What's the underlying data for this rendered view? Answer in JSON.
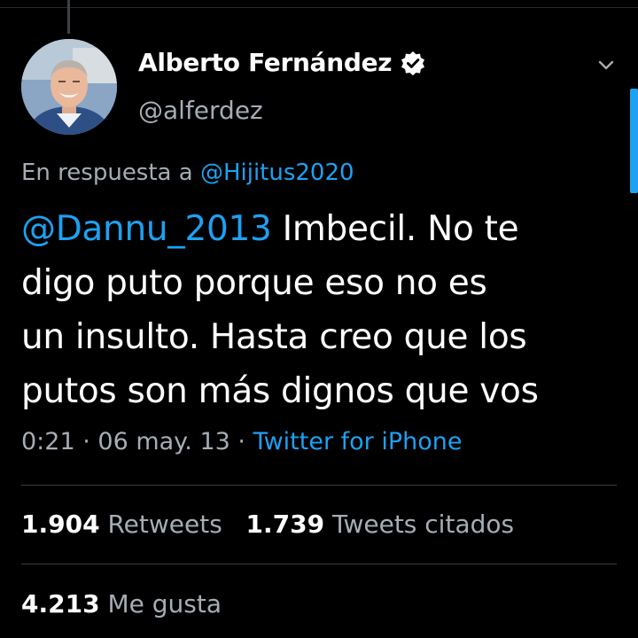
{
  "author": {
    "display_name": "Alberto Fernández",
    "handle": "@alferdez"
  },
  "reply": {
    "prefix": "En respuesta a ",
    "to": "@Hijitus2020"
  },
  "tweet": {
    "mention": "@Dannu_2013",
    "line1_rest": " Imbecil. No te",
    "line2": "digo puto porque eso no es",
    "line3": "un insulto. Hasta creo que los",
    "line4": "putos son más dignos que vos"
  },
  "meta": {
    "time": "0:21",
    "sep1": " · ",
    "date": "06 may. 13",
    "sep2": " · ",
    "source": "Twitter for iPhone"
  },
  "stats": {
    "retweets_count": "1.904",
    "retweets_label": "Retweets",
    "quotes_count": "1.739",
    "quotes_label": "Tweets citados",
    "likes_count": "4.213",
    "likes_label": "Me gusta"
  },
  "colors": {
    "background": "#000000",
    "accent": "#1da1f2",
    "secondary_text": "#a5adb5",
    "divider": "#3a3d40"
  },
  "icons": {
    "verified": "verified-badge-icon",
    "menu": "chevron-down-icon"
  }
}
